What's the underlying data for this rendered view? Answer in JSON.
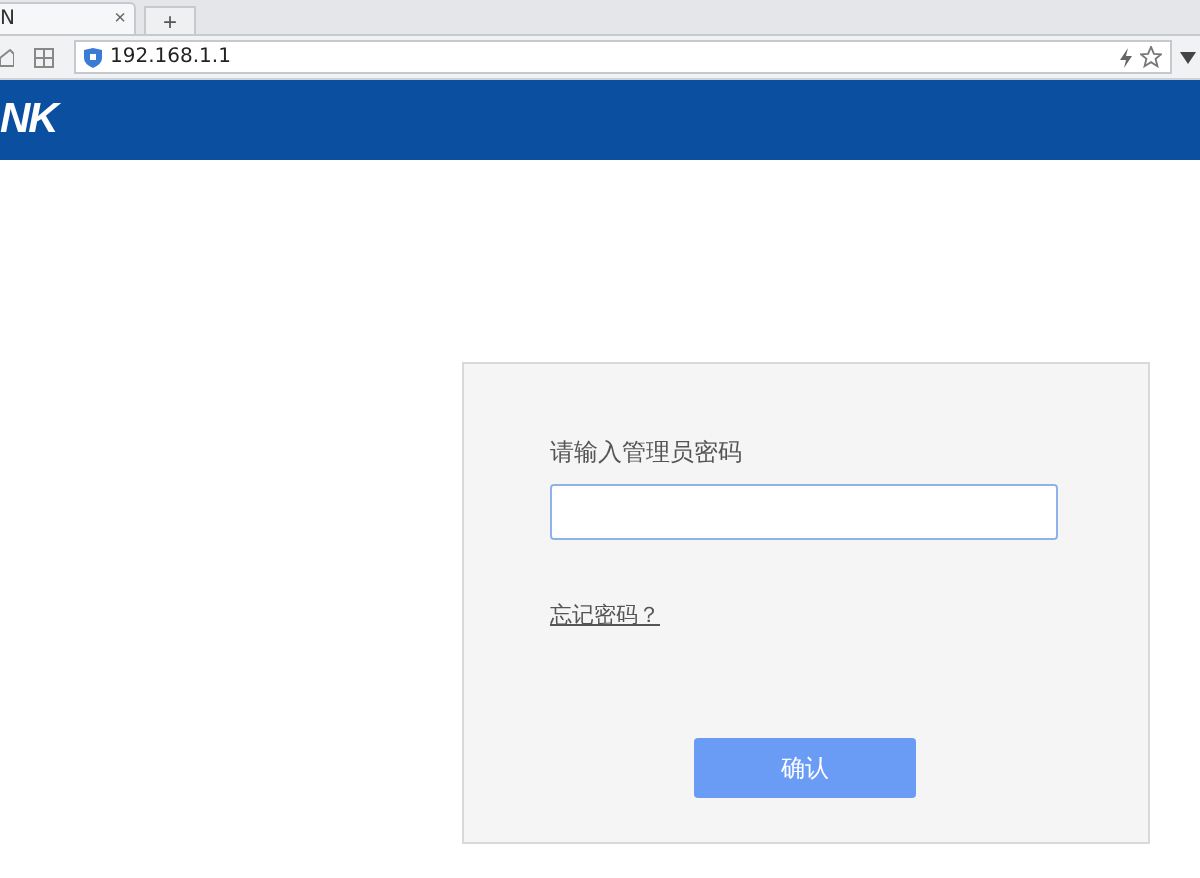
{
  "browser": {
    "tab": {
      "title": "N",
      "close": "×"
    },
    "new_tab": "+",
    "address": "192.168.1.1"
  },
  "header": {
    "logo": "NK"
  },
  "login": {
    "label": "请输入管理员密码",
    "forgot_link": "忘记密码？",
    "confirm_button": "确认"
  }
}
